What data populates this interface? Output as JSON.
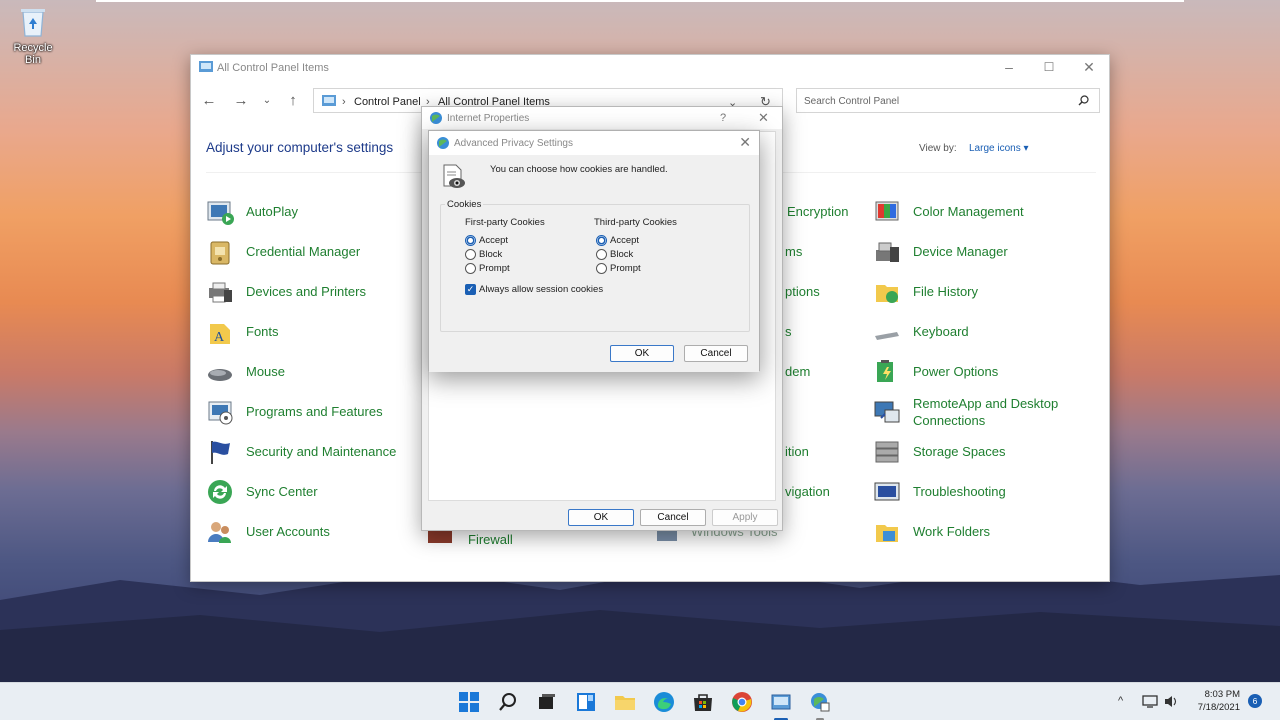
{
  "desktop": {
    "recycle_bin": "Recycle Bin"
  },
  "control_panel": {
    "title": "All Control Panel Items",
    "breadcrumb": [
      "Control Panel",
      "All Control Panel Items"
    ],
    "search_placeholder": "Search Control Panel",
    "heading": "Adjust your computer's settings",
    "view_by_label": "View by:",
    "view_by_value": "Large icons",
    "items_left": [
      {
        "label": "AutoPlay",
        "icon": "autoplay-icon"
      },
      {
        "label": "Credential Manager",
        "icon": "credential-manager-icon"
      },
      {
        "label": "Devices and Printers",
        "icon": "devices-printers-icon"
      },
      {
        "label": "Fonts",
        "icon": "fonts-icon"
      },
      {
        "label": "Mouse",
        "icon": "mouse-icon"
      },
      {
        "label": "Programs and Features",
        "icon": "programs-features-icon"
      },
      {
        "label": "Security and Maintenance",
        "icon": "security-flag-icon"
      },
      {
        "label": "Sync Center",
        "icon": "sync-center-icon"
      },
      {
        "label": "User Accounts",
        "icon": "user-accounts-icon"
      }
    ],
    "items_middle_partial": [
      "Encryption",
      "ms",
      "ptions",
      "s",
      "dem",
      "ition",
      "vigation"
    ],
    "items_bottom_partial": [
      "Firewall",
      "Windows Tools"
    ],
    "items_right": [
      {
        "label": "Color Management",
        "icon": "color-management-icon"
      },
      {
        "label": "Device Manager",
        "icon": "device-manager-icon"
      },
      {
        "label": "File History",
        "icon": "file-history-icon"
      },
      {
        "label": "Keyboard",
        "icon": "keyboard-icon"
      },
      {
        "label": "Power Options",
        "icon": "power-options-icon"
      },
      {
        "label": "RemoteApp and Desktop Connections",
        "icon": "remoteapp-icon"
      },
      {
        "label": "Storage Spaces",
        "icon": "storage-spaces-icon"
      },
      {
        "label": "Troubleshooting",
        "icon": "troubleshooting-icon"
      },
      {
        "label": "Work Folders",
        "icon": "work-folders-icon"
      }
    ]
  },
  "internet_properties": {
    "title": "Internet Properties",
    "help": "?",
    "ok": "OK",
    "cancel": "Cancel",
    "apply": "Apply"
  },
  "advanced_privacy": {
    "title": "Advanced Privacy Settings",
    "description": "You can choose how cookies are handled.",
    "group_label": "Cookies",
    "first_party_label": "First-party Cookies",
    "third_party_label": "Third-party Cookies",
    "options": [
      "Accept",
      "Block",
      "Prompt"
    ],
    "first_party_selected": "Accept",
    "third_party_selected": "Accept",
    "session_cookies_label": "Always allow session cookies",
    "session_cookies_checked": true,
    "ok": "OK",
    "cancel": "Cancel"
  },
  "taskbar": {
    "time": "8:03 PM",
    "date": "7/18/2021",
    "notifications": "6",
    "accent": "#1a5fb4"
  }
}
